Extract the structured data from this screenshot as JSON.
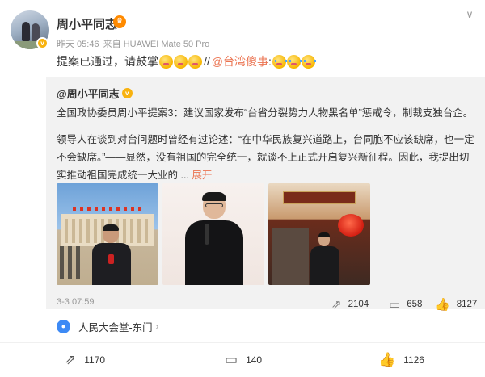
{
  "post": {
    "author": "周小平同志",
    "time": "昨天 05:46",
    "source": "来自 HUAWEI Mate 50 Pro",
    "text_main": "提案已通过，请鼓掌",
    "text_sep": "//",
    "topic": "@台湾傻事",
    "text_colon": ":"
  },
  "repost": {
    "author": "@周小平同志",
    "line1": "全国政协委员周小平提案3：建议国家发布“台省分裂势力人物黑名单”惩戒令，制裁支独台企。",
    "paragraph": "领导人在谈到对台问题时曾经有过论述：“在中华民族复兴道路上，台同胞不应该缺席，也一定不会缺席。”——显然，没有祖国的完全统一，就谈不上正式开启复兴新征程。因此，我提出切实推动祖国完成统一大业的 ...",
    "expand": "展开",
    "date": "3-3 07:59",
    "reposts": "2104",
    "comments": "658",
    "likes": "8127"
  },
  "location": {
    "name": "人民大会堂-东门",
    "arrow": "›"
  },
  "actions": {
    "reposts": "1170",
    "comments": "140",
    "likes": "1126"
  },
  "icons": {
    "more": "chevron-down-icon",
    "location": "location-pin-icon",
    "repost": "repost-icon",
    "comment": "comment-icon",
    "like": "thumbs-up-icon"
  },
  "colors": {
    "accent": "#eb7350",
    "verify": "#f8b20f",
    "location": "#3d8af5",
    "card_bg": "#f2f2f2"
  }
}
